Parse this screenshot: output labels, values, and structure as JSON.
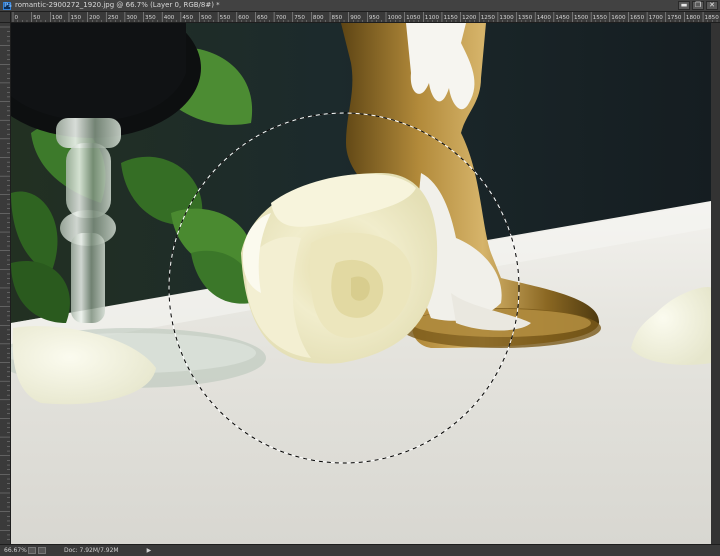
{
  "titlebar": {
    "app_badge": "Ps",
    "title": "romantic-2900272_1920.jpg @ 66.7% (Layer 0, RGB/8#) *",
    "minimize": "▬",
    "restore": "❐",
    "close": "✕"
  },
  "ruler": {
    "h_labels": [
      "0",
      "50",
      "100",
      "150",
      "200",
      "250",
      "300",
      "350",
      "400",
      "450",
      "500",
      "550",
      "600",
      "650",
      "700",
      "750",
      "800",
      "850",
      "900",
      "950",
      "1000",
      "1050",
      "1100",
      "1150",
      "1200",
      "1250",
      "1300",
      "1350",
      "1400",
      "1450",
      "1500",
      "1550",
      "1600",
      "1650",
      "1700",
      "1750",
      "1800",
      "1850"
    ]
  },
  "status": {
    "zoom": "66.67%",
    "doc": "Doc: 7.92M/7.92M",
    "arrow": "▶"
  },
  "colors": {
    "background": "#1a242a",
    "tablecloth": "#e9e8e2",
    "rose": "#efeccb",
    "candle_gold": "#9a7a2c",
    "leaf": "#3f7f2e"
  },
  "icons": {
    "app": "photoshop-icon",
    "selection": "elliptical-marquee",
    "status": [
      "screen-mode-icon",
      "quick-mask-icon"
    ]
  }
}
